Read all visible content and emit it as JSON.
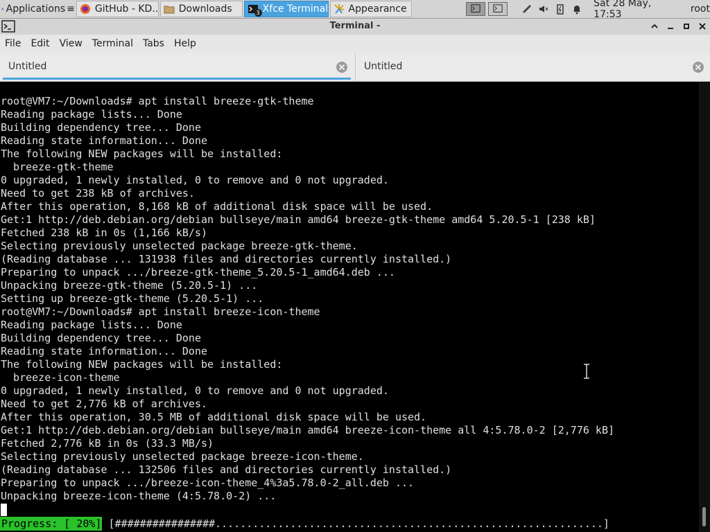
{
  "panel": {
    "applications_label": "Applications",
    "tasks": [
      {
        "label": "GitHub - KD...",
        "icon": "firefox-icon"
      },
      {
        "label": "Downloads",
        "icon": "folder-icon"
      },
      {
        "label": "Xfce Terminal",
        "icon": "terminal-icon",
        "badge": "3",
        "active": true
      },
      {
        "label": "Appearance",
        "icon": "appearance-icon"
      }
    ],
    "clock": "Sat 28 May, 17:53",
    "user": "root",
    "colors": {
      "active_task": "#4aa3df",
      "panel_bg": "#d4d4d4"
    }
  },
  "window": {
    "title": "Terminal -"
  },
  "menubar": {
    "items": [
      "File",
      "Edit",
      "View",
      "Terminal",
      "Tabs",
      "Help"
    ]
  },
  "tabs": [
    {
      "label": "Untitled",
      "active": true
    },
    {
      "label": "Untitled",
      "active": false
    }
  ],
  "terminal": {
    "lines": [
      "root@VM7:~/Downloads# apt install breeze-gtk-theme",
      "Reading package lists... Done",
      "Building dependency tree... Done",
      "Reading state information... Done",
      "The following NEW packages will be installed:",
      "  breeze-gtk-theme",
      "0 upgraded, 1 newly installed, 0 to remove and 0 not upgraded.",
      "Need to get 238 kB of archives.",
      "After this operation, 8,168 kB of additional disk space will be used.",
      "Get:1 http://deb.debian.org/debian bullseye/main amd64 breeze-gtk-theme amd64 5.20.5-1 [238 kB]",
      "Fetched 238 kB in 0s (1,166 kB/s)",
      "Selecting previously unselected package breeze-gtk-theme.",
      "(Reading database ... 131938 files and directories currently installed.)",
      "Preparing to unpack .../breeze-gtk-theme_5.20.5-1_amd64.deb ...",
      "Unpacking breeze-gtk-theme (5.20.5-1) ...",
      "Setting up breeze-gtk-theme (5.20.5-1) ...",
      "root@VM7:~/Downloads# apt install breeze-icon-theme",
      "Reading package lists... Done",
      "Building dependency tree... Done",
      "Reading state information... Done",
      "The following NEW packages will be installed:",
      "  breeze-icon-theme",
      "0 upgraded, 1 newly installed, 0 to remove and 0 not upgraded.",
      "Need to get 2,776 kB of archives.",
      "After this operation, 30.5 MB of additional disk space will be used.",
      "Get:1 http://deb.debian.org/debian bullseye/main amd64 breeze-icon-theme all 4:5.78.0-2 [2,776 kB]",
      "Fetched 2,776 kB in 0s (33.3 MB/s)",
      "Selecting previously unselected package breeze-icon-theme.",
      "(Reading database ... 132506 files and directories currently installed.)",
      "Preparing to unpack .../breeze-icon-theme_4%3a5.78.0-2_all.deb ...",
      "Unpacking breeze-icon-theme (4:5.78.0-2) ..."
    ],
    "progress_label": "Progress: [ 20%]",
    "progress_bar": "[################..............................................................]",
    "progress_percent": 20,
    "colors": {
      "progress": "#2ac12a",
      "text": "#e0e0e0",
      "background": "#000000"
    }
  }
}
